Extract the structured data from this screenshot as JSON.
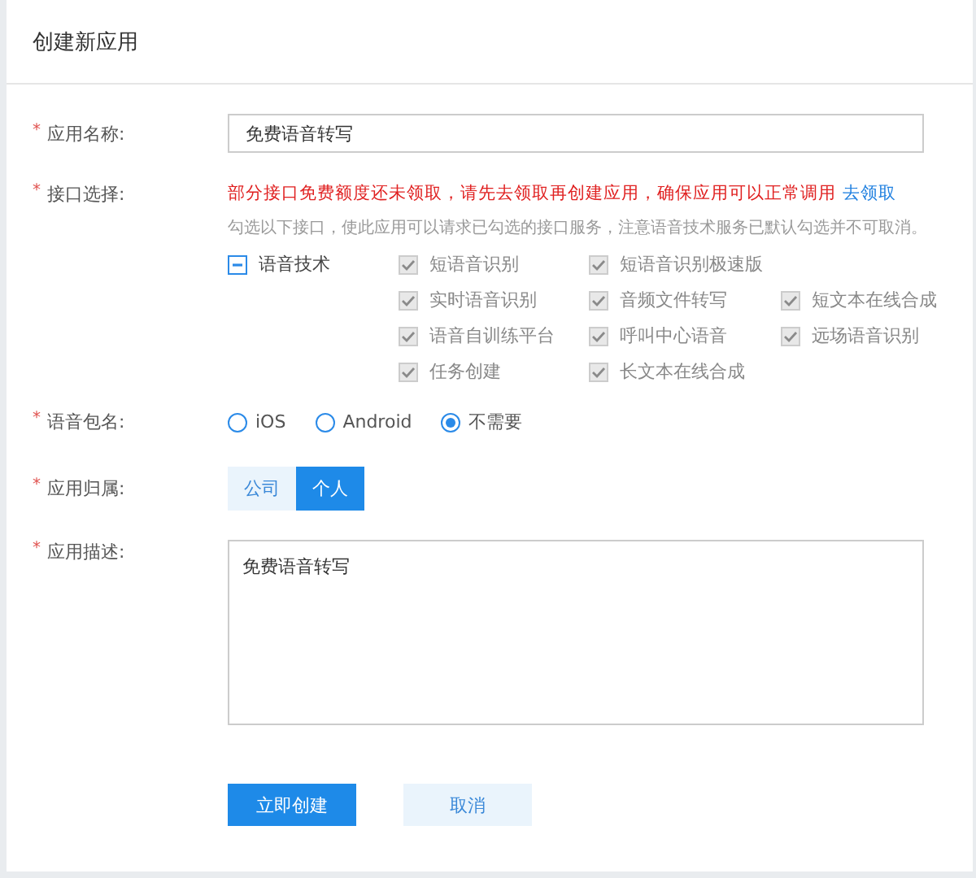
{
  "title": "创建新应用",
  "fields": [
    {
      "kind": "text",
      "label": "应用名称:",
      "mark": "*",
      "value": "免费语音转写"
    },
    {
      "kind": "services",
      "label": "接口选择:",
      "mark": "*",
      "warning": "部分接口免费额度还未领取，请先去领取再创建应用，确保应用可以正常调用",
      "warning_link": "去领取",
      "hint": "勾选以下接口，使此应用可以请求已勾选的接口服务，注意语音技术服务已默认勾选并不可取消。",
      "category": {
        "label": "语音技术",
        "indeterminate": true
      },
      "rows": [
        {
          "items": [
            {
              "label": "短语音识别",
              "checked": true,
              "disabled": true
            },
            {
              "label": "短语音识别极速版",
              "checked": true,
              "disabled": true
            }
          ]
        },
        {
          "items": [
            {
              "label": "实时语音识别",
              "checked": true,
              "disabled": true
            },
            {
              "label": "音频文件转写",
              "checked": true,
              "disabled": true
            },
            {
              "label": "短文本在线合成",
              "checked": true,
              "disabled": true
            }
          ]
        },
        {
          "items": [
            {
              "label": "语音自训练平台",
              "checked": true,
              "disabled": true
            },
            {
              "label": "呼叫中心语音",
              "checked": true,
              "disabled": true
            },
            {
              "label": "远场语音识别",
              "checked": true,
              "disabled": true
            }
          ]
        },
        {
          "items": [
            {
              "label": "任务创建",
              "checked": true,
              "disabled": true
            },
            {
              "label": "长文本在线合成",
              "checked": true,
              "disabled": true
            }
          ]
        }
      ]
    },
    {
      "kind": "radio",
      "label": "语音包名:",
      "mark": "*",
      "options": [
        {
          "label": "iOS",
          "selected": false
        },
        {
          "label": "Android",
          "selected": false
        },
        {
          "label": "不需要",
          "selected": true
        }
      ]
    },
    {
      "kind": "toggle",
      "label": "应用归属:",
      "mark": "*",
      "options": [
        {
          "label": "公司",
          "selected": false
        },
        {
          "label": "个人",
          "selected": true
        }
      ]
    },
    {
      "kind": "textarea",
      "label": "应用描述:",
      "mark": "*",
      "value": "免费语音转写"
    }
  ],
  "buttons": [
    {
      "label": "立即创建",
      "kind": "primary"
    },
    {
      "label": "取消",
      "kind": "secondary"
    }
  ]
}
